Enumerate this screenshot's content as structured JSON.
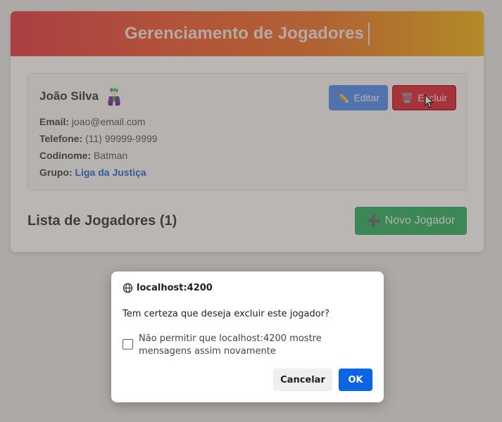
{
  "app": {
    "title": "Gerenciamento de Jogadores"
  },
  "player": {
    "name": "João Silva",
    "hero_icon": "joker-figure-icon",
    "email_label": "Email:",
    "email": "joao@email.com",
    "phone_label": "Telefone:",
    "phone": "(11) 99999-9999",
    "codename_label": "Codinome:",
    "codename": "Batman",
    "group_label": "Grupo:",
    "group": "Liga da Justiça",
    "edit_icon": "✏️",
    "edit_label": "Editar",
    "delete_icon": "🗑️",
    "delete_label": "Excluir"
  },
  "list": {
    "title": "Lista de Jogadores (1)",
    "new_icon": "➕",
    "new_label": "Novo Jogador"
  },
  "dialog": {
    "origin": "localhost:4200",
    "message": "Tem certeza que deseja excluir este jogador?",
    "checkbox_label": "Não permitir que localhost:4200 mostre mensagens assim novamente",
    "cancel_label": "Cancelar",
    "ok_label": "OK"
  },
  "colors": {
    "header_gradient_start": "#e8323f",
    "header_gradient_end": "#f1b40f",
    "edit_button": "#4a8cf5",
    "delete_button": "#dc1f2e",
    "new_button": "#27ae5f",
    "dialog_ok": "#0b63e5",
    "link": "#1e5fd8"
  }
}
